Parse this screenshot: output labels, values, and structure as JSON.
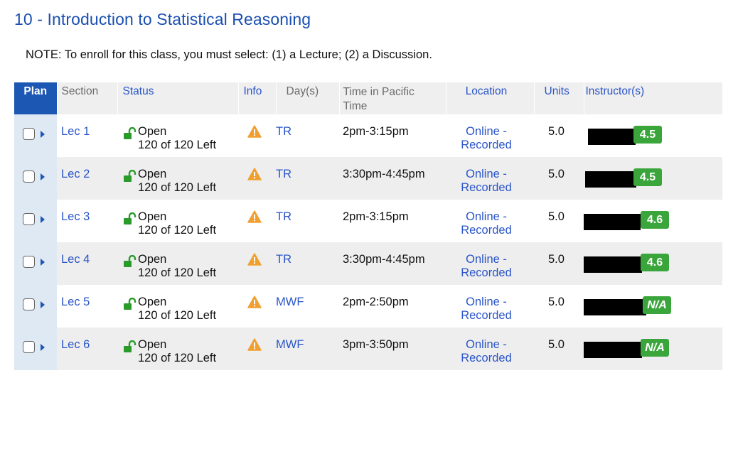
{
  "page": {
    "title": "10 - Introduction to Statistical Reasoning",
    "note": "NOTE: To enroll for this class, you must select: (1) a Lecture; (2) a Discussion."
  },
  "colors": {
    "title": "#1a4fb0",
    "link": "#2a55c8",
    "plan_header_bg": "#1d57b4",
    "rating_green": "#3aa53a",
    "warning_orange": "#f0a030",
    "lock_green": "#2a9a2a"
  },
  "table": {
    "headers": {
      "plan": "Plan",
      "section": "Section",
      "status": "Status",
      "info": "Info",
      "days": "Day(s)",
      "time": "Time in Pacific Time",
      "location": "Location",
      "units": "Units",
      "instructors": "Instructor(s)"
    },
    "rows": [
      {
        "section": "Lec 1",
        "status": "Open",
        "seats": "120 of 120 Left",
        "info_icon": "warning-icon",
        "days": "TR",
        "time": "2pm-3:15pm",
        "location_line1": "Online -",
        "location_line2": "Recorded",
        "units": "5.0",
        "rating": "4.5"
      },
      {
        "section": "Lec 2",
        "status": "Open",
        "seats": "120 of 120 Left",
        "info_icon": "warning-icon",
        "days": "TR",
        "time": "3:30pm-4:45pm",
        "location_line1": "Online -",
        "location_line2": "Recorded",
        "units": "5.0",
        "rating": "4.5"
      },
      {
        "section": "Lec 3",
        "status": "Open",
        "seats": "120 of 120 Left",
        "info_icon": "warning-icon",
        "days": "TR",
        "time": "2pm-3:15pm",
        "location_line1": "Online -",
        "location_line2": "Recorded",
        "units": "5.0",
        "rating": "4.6"
      },
      {
        "section": "Lec 4",
        "status": "Open",
        "seats": "120 of 120 Left",
        "info_icon": "warning-icon",
        "days": "TR",
        "time": "3:30pm-4:45pm",
        "location_line1": "Online -",
        "location_line2": "Recorded",
        "units": "5.0",
        "rating": "4.6"
      },
      {
        "section": "Lec 5",
        "status": "Open",
        "seats": "120 of 120 Left",
        "info_icon": "warning-icon",
        "days": "MWF",
        "time": "2pm-2:50pm",
        "location_line1": "Online -",
        "location_line2": "Recorded",
        "units": "5.0",
        "rating": "N/A"
      },
      {
        "section": "Lec 6",
        "status": "Open",
        "seats": "120 of 120 Left",
        "info_icon": "warning-icon",
        "days": "MWF",
        "time": "3pm-3:50pm",
        "location_line1": "Online -",
        "location_line2": "Recorded",
        "units": "5.0",
        "rating": "N/A"
      }
    ]
  }
}
